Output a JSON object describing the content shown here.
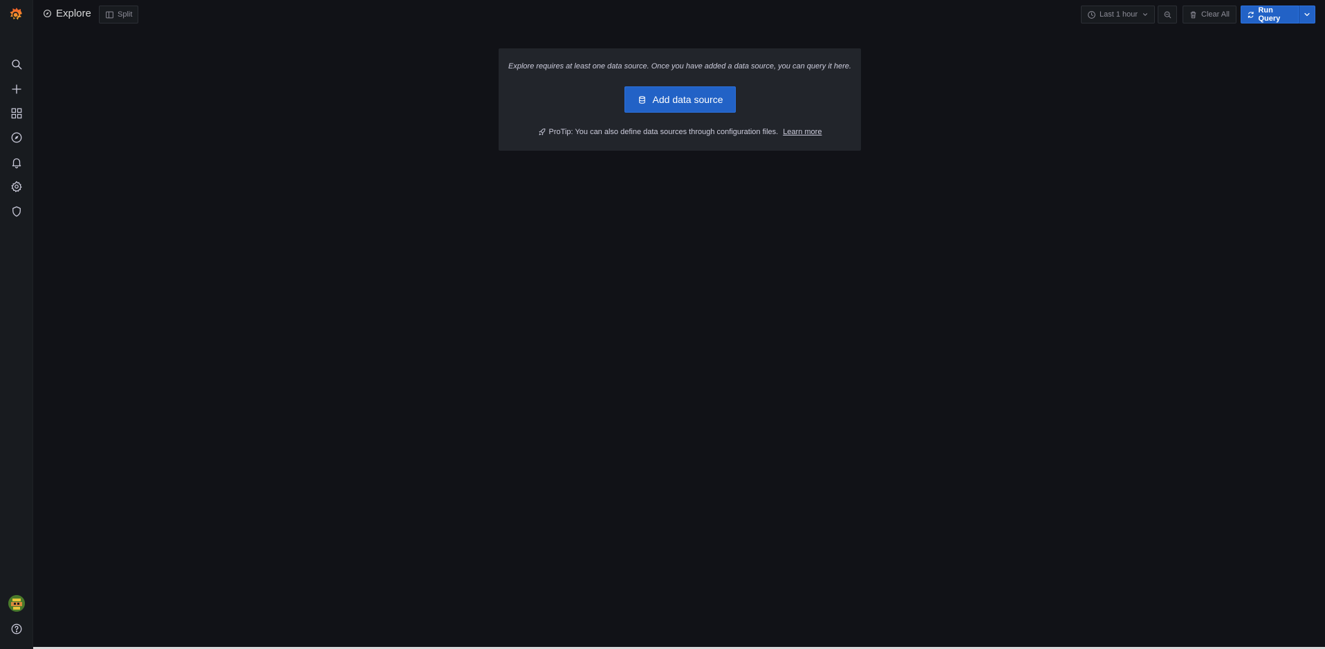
{
  "header": {
    "title": "Explore",
    "split_label": "Split",
    "time_range_label": "Last 1 hour",
    "clear_all_label": "Clear All",
    "run_query_label": "Run Query"
  },
  "sidebar": {
    "items": [
      {
        "icon": "search-icon"
      },
      {
        "icon": "plus-icon"
      },
      {
        "icon": "dashboards-icon"
      },
      {
        "icon": "compass-icon"
      },
      {
        "icon": "bell-icon"
      },
      {
        "icon": "gear-icon"
      },
      {
        "icon": "shield-icon"
      }
    ],
    "bottom": [
      {
        "icon": "avatar"
      },
      {
        "icon": "help-icon"
      }
    ]
  },
  "empty_state": {
    "message": "Explore requires at least one data source. Once you have added a data source, you can query it here.",
    "add_button_label": "Add data source",
    "protip_text": "ProTip: You can also define data sources through configuration files.",
    "learn_more_label": "Learn more"
  },
  "colors": {
    "background": "#111217",
    "sidebar": "#181b1f",
    "panel": "#22252b",
    "primary": "#2262c6",
    "logo": "#f46800"
  }
}
